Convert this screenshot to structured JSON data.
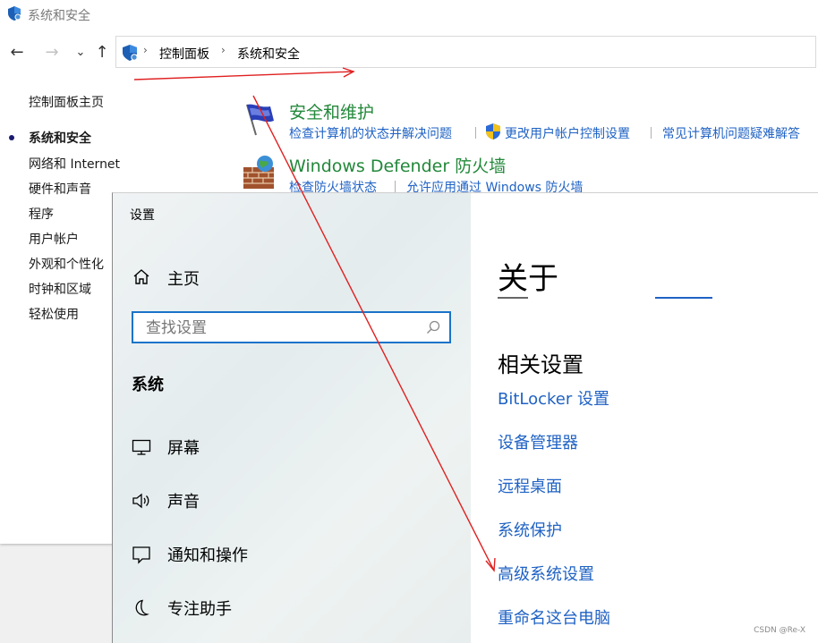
{
  "control_panel": {
    "window_title": "系统和安全",
    "breadcrumb": [
      "控制面板",
      "系统和安全"
    ],
    "left_nav": [
      {
        "label": "控制面板主页",
        "active": false
      },
      {
        "label": "系统和安全",
        "active": true
      },
      {
        "label": "网络和 Internet",
        "active": false
      },
      {
        "label": "硬件和声音",
        "active": false
      },
      {
        "label": "程序",
        "active": false
      },
      {
        "label": "用户帐户",
        "active": false
      },
      {
        "label": "外观和个性化",
        "active": false
      },
      {
        "label": "时钟和区域",
        "active": false
      },
      {
        "label": "轻松使用",
        "active": false
      }
    ],
    "categories": [
      {
        "title": "安全和维护",
        "icon": "flag-icon",
        "links": [
          "检查计算机的状态并解决问题",
          "更改用户帐户控制设置",
          "常见计算机问题疑难解答"
        ]
      },
      {
        "title": "Windows Defender 防火墙",
        "icon": "firewall-icon",
        "links": [
          "检查防火墙状态",
          "允许应用通过 Windows 防火墙"
        ]
      }
    ]
  },
  "settings": {
    "window_title": "设置",
    "home_label": "主页",
    "search_placeholder": "查找设置",
    "section_title": "系统",
    "menu": [
      {
        "label": "屏幕",
        "icon": "monitor-icon"
      },
      {
        "label": "声音",
        "icon": "speaker-icon"
      },
      {
        "label": "通知和操作",
        "icon": "notification-icon"
      },
      {
        "label": "专注助手",
        "icon": "moon-icon"
      }
    ],
    "page_title": "关于",
    "related_title": "相关设置",
    "related_links": [
      "BitLocker 设置",
      "设备管理器",
      "远程桌面",
      "系统保护",
      "高级系统设置",
      "重命名这台电脑"
    ]
  },
  "watermark": "CSDN @Re-X",
  "colors": {
    "link_blue": "#1f62c4",
    "category_green": "#22883a",
    "annotation_red": "#e02020",
    "search_border": "#1a73c8"
  }
}
